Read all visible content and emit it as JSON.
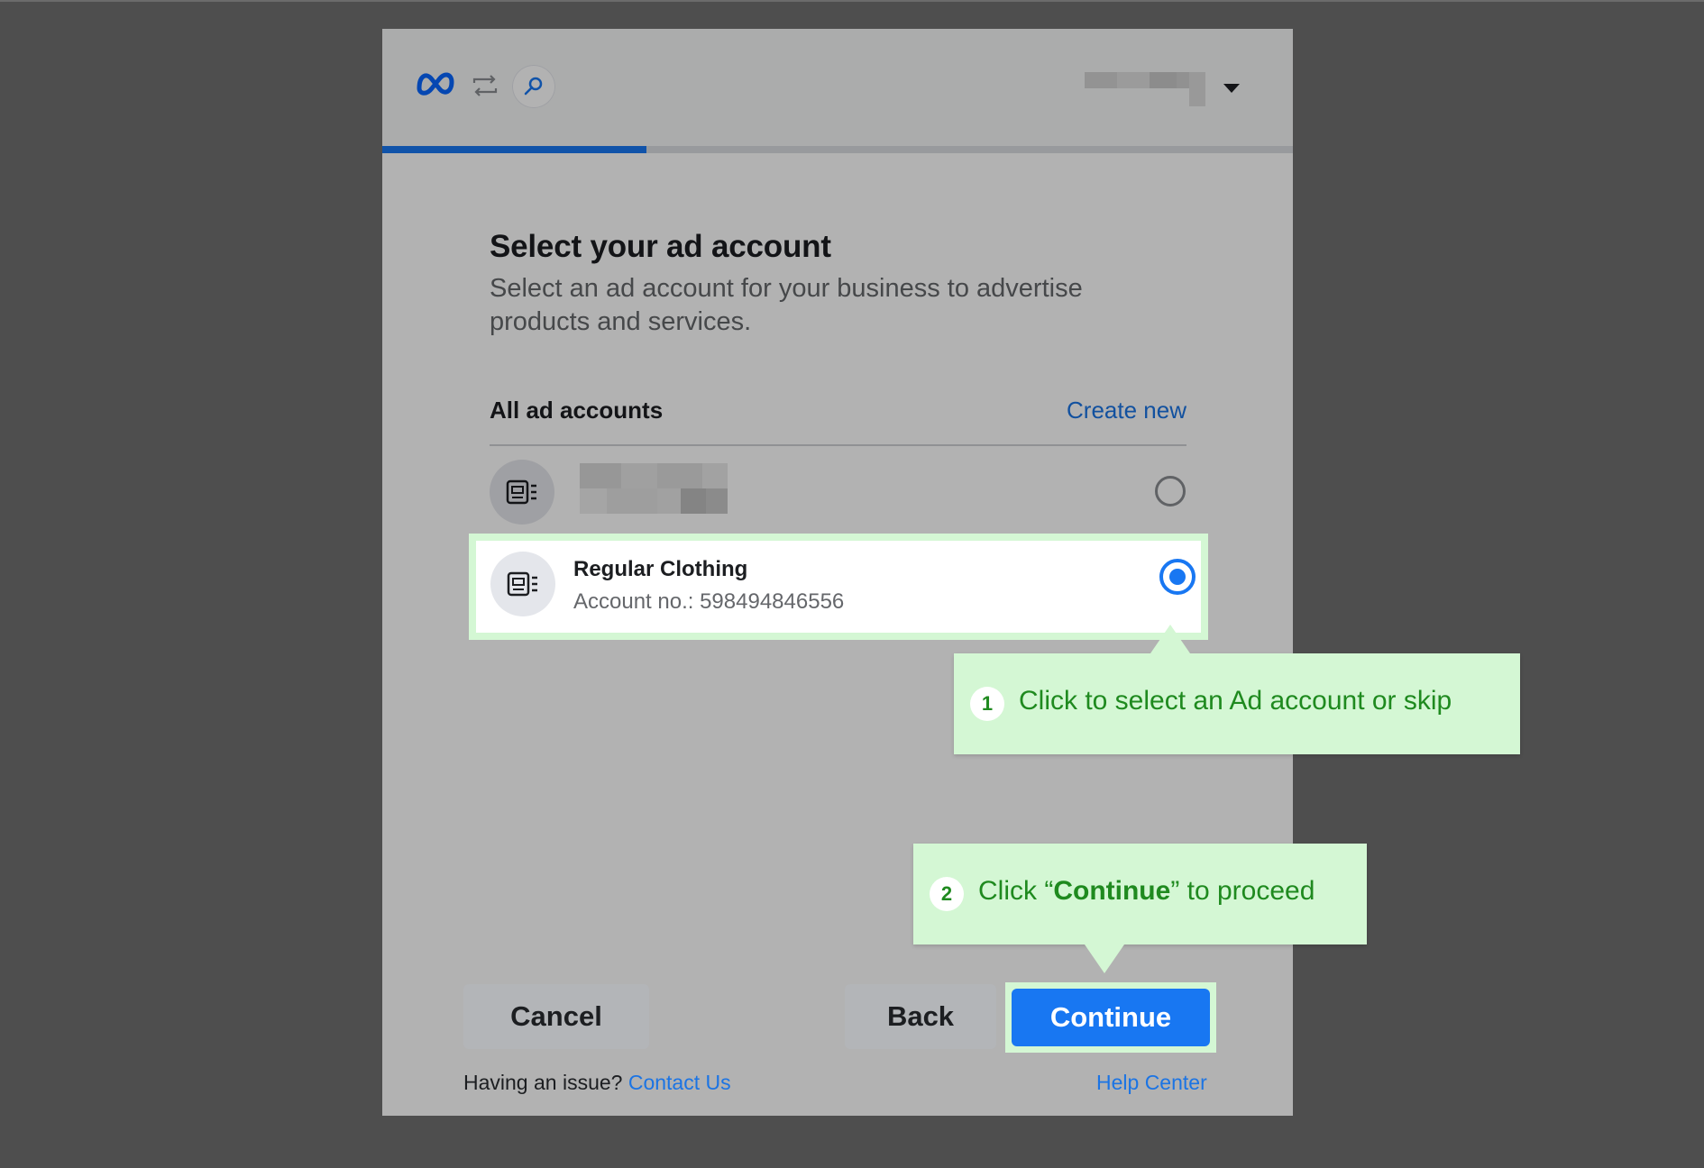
{
  "header": {
    "logo_icon": "meta-logo-icon",
    "sync_icon": "sync-arrows-icon",
    "link_icon": "link-icon",
    "account_dropdown_icon": "caret-down-icon",
    "progress_percent": 29
  },
  "main": {
    "title": "Select your ad account",
    "subtitle": "Select an ad account for your business to advertise products and services.",
    "list_header": "All ad accounts",
    "create_new": "Create new",
    "accounts": [
      {
        "name": "",
        "account_no": "",
        "selected": false
      },
      {
        "name": "Regular Clothing",
        "account_no": "Account no.: 598494846556",
        "selected": true
      }
    ]
  },
  "callouts": [
    {
      "step": "1",
      "text": "Click to select an Ad account or skip"
    },
    {
      "step": "2",
      "text_before": "Click “",
      "text_bold": "Continue",
      "text_after": "” to proceed"
    }
  ],
  "footer": {
    "cancel": "Cancel",
    "back": "Back",
    "continue": "Continue",
    "issue_text": "Having an issue?",
    "contact_us": "Contact Us",
    "help_center": "Help Center"
  },
  "colors": {
    "accent": "#1877f2",
    "link": "#1b74e4",
    "callout_bg": "#d4f7d4",
    "callout_text": "#1f8a1f"
  }
}
